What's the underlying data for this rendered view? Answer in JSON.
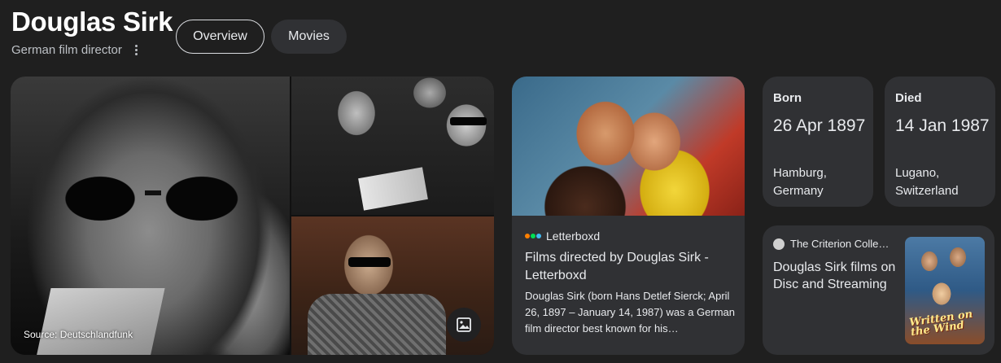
{
  "entity": {
    "name": "Douglas Sirk",
    "description": "German film director"
  },
  "tabs": [
    {
      "label": "Overview",
      "selected": true
    },
    {
      "label": "Movies",
      "selected": false
    }
  ],
  "images": {
    "source_caption": "Source: Deutschlandfunk"
  },
  "letterboxd": {
    "source": "Letterboxd",
    "title": "Films directed by Douglas Sirk - Letterboxd",
    "snippet": "Douglas Sirk (born Hans Detlef Sierck; April 26, 1897 – January 14, 1987) was a German film director best known for his…"
  },
  "born": {
    "label": "Born",
    "date": "26 Apr 1897",
    "place": "Hamburg, Germany"
  },
  "died": {
    "label": "Died",
    "date": "14 Jan 1987",
    "place": "Lugano, Switzerland"
  },
  "criterion": {
    "source": "The Criterion Colle…",
    "title": "Douglas Sirk films on Disc and Streaming",
    "poster_title": "Written on the Wind"
  },
  "colors": {
    "background": "#1f1f1f",
    "card": "#303134",
    "text": "#e8eaed",
    "muted": "#bdc1c6"
  }
}
